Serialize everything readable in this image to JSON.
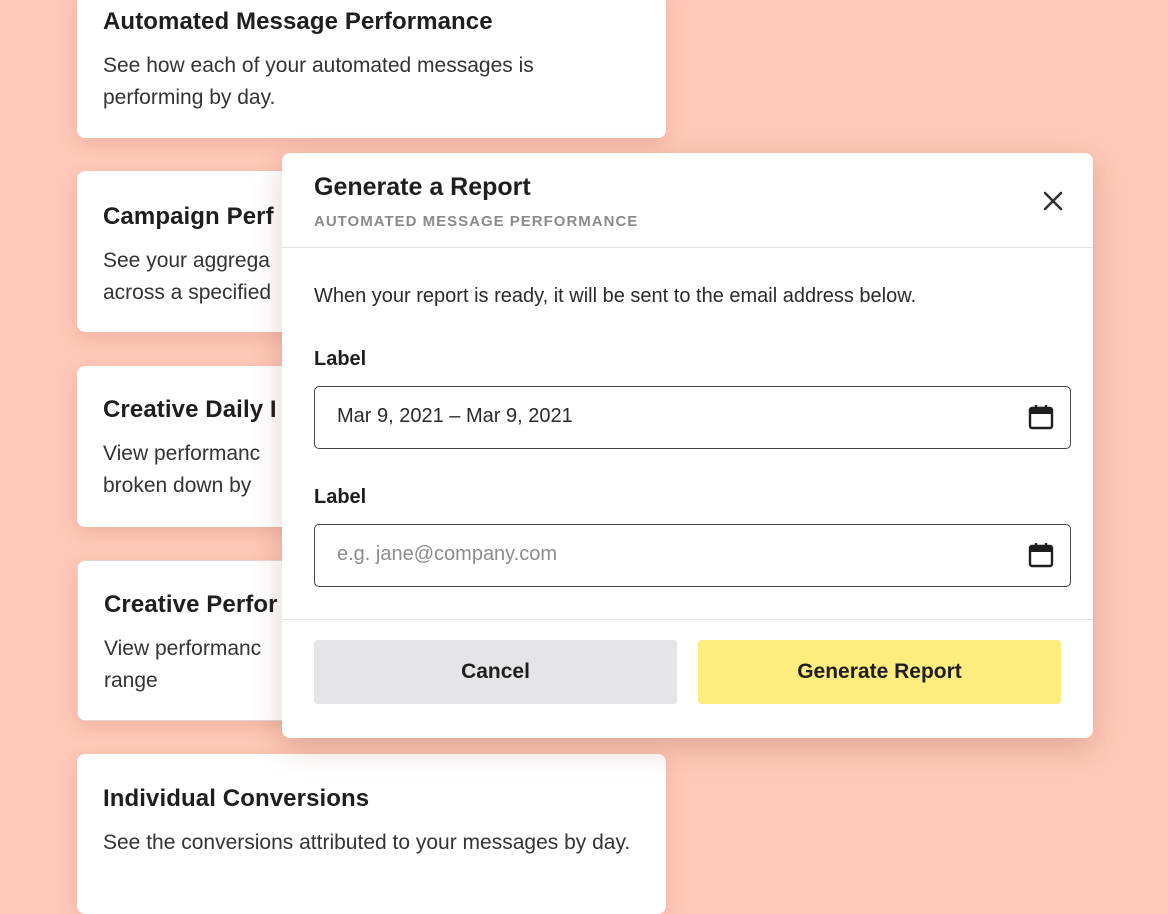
{
  "colors": {
    "background": "#ffc8b8",
    "card": "#ffffff",
    "primary_button": "#fdec7e",
    "secondary_button": "#e5e4e7"
  },
  "cards": [
    {
      "title": "Automated Message Performance",
      "desc": "See how each of your automated messages is performing by day."
    },
    {
      "title": "Campaign Perf",
      "desc": "See your aggrega across a specified"
    },
    {
      "title": "Creative Daily I",
      "desc": "View performanc broken down by"
    },
    {
      "title": "Creative Perfor",
      "desc": "View performanc range"
    },
    {
      "title": "Individual Conversions",
      "desc": "See the conversions attributed to your messages by day."
    }
  ],
  "modal": {
    "title": "Generate a Report",
    "subtitle": "AUTOMATED MESSAGE PERFORMANCE",
    "close_icon": "close-icon",
    "body_text": "When your report is ready, it will be sent to the email address below.",
    "fields": [
      {
        "label": "Label",
        "value": "Mar 9, 2021 – Mar 9, 2021",
        "icon": "calendar-icon"
      },
      {
        "label": "Label",
        "placeholder": "e.g. jane@company.com",
        "icon": "calendar-icon"
      }
    ],
    "cancel_label": "Cancel",
    "generate_label": "Generate Report"
  }
}
